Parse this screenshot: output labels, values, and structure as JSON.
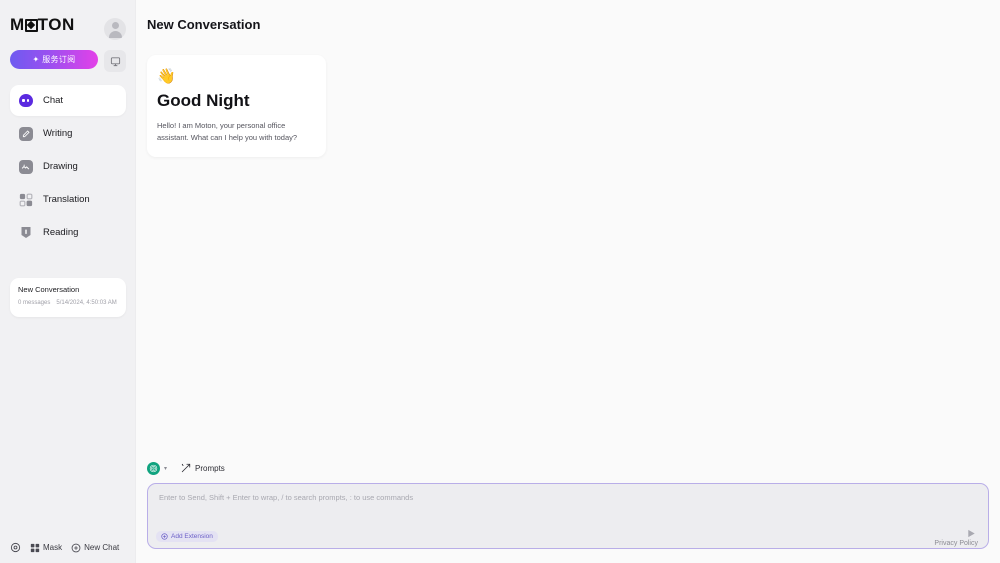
{
  "sidebar": {
    "logo_pre": "M",
    "logo_post": "TON",
    "subscribe": {
      "label": "服务订阅",
      "icon": "sparkle-icon"
    },
    "nav_items": [
      {
        "label": "Chat",
        "icon": "chat-bubble-icon",
        "active": true
      },
      {
        "label": "Writing",
        "icon": "pencil-icon",
        "active": false
      },
      {
        "label": "Drawing",
        "icon": "image-icon",
        "active": false
      },
      {
        "label": "Translation",
        "icon": "translate-icon",
        "active": false
      },
      {
        "label": "Reading",
        "icon": "book-icon",
        "active": false
      }
    ],
    "conversation": {
      "title": "New Conversation",
      "messages": "0 messages",
      "timestamp": "5/14/2024, 4:50:03 AM"
    },
    "bottom": {
      "settings_icon": "gear-icon",
      "mask_label": "Mask",
      "new_chat_label": "New Chat"
    },
    "colors": {
      "accent_start": "#6e5bf0",
      "accent_end": "#e341e8",
      "chat_icon": "#5b2ae0"
    }
  },
  "main": {
    "header_title": "New Conversation",
    "greeting": {
      "emoji": "👋",
      "title": "Good Night",
      "description": "Hello! I am Moton, your personal office assistant. What can I help you with today?"
    },
    "toolbar": {
      "model_icon": "openai-logo-icon",
      "model_chevron": "▾",
      "prompts_label": "Prompts"
    },
    "composer": {
      "placeholder": "Enter to Send, Shift + Enter to wrap, / to search prompts, : to use commands",
      "value": "",
      "add_extension_label": "Add Extension",
      "send_icon": "send-arrow-icon"
    },
    "privacy_label": "Privacy Policy",
    "colors": {
      "input_border": "#b9aee8",
      "model_green": "#10a37f"
    }
  }
}
